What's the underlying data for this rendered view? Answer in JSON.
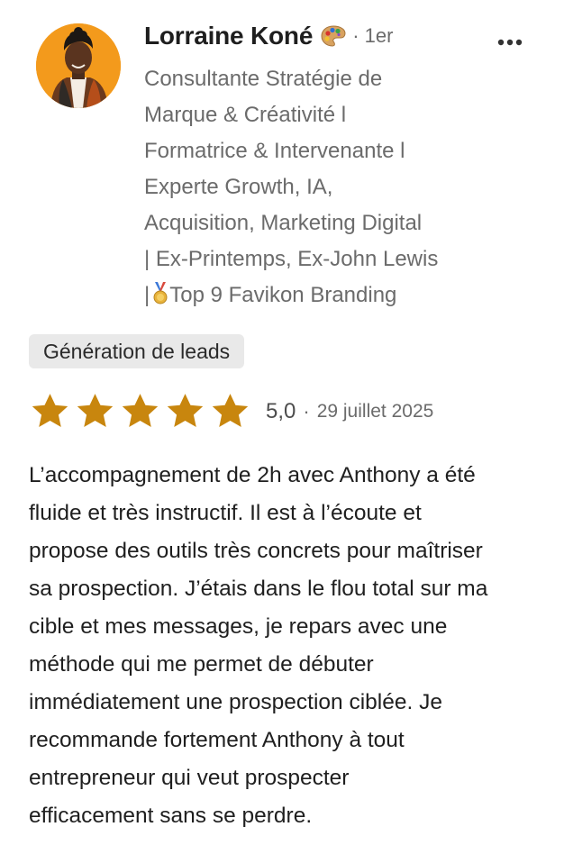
{
  "reviewer": {
    "name": "Lorraine Koné",
    "emoji_icon": "artist-palette-icon",
    "degree": "· 1er",
    "headline_lines": [
      "Consultante Stratégie de",
      "Marque & Créativité l",
      "Formatrice & Intervenante l",
      "Experte Growth, IA,",
      "Acquisition, Marketing Digital",
      "| Ex-Printemps, Ex-John Lewis"
    ],
    "headline_last_prefix": "|",
    "headline_last_icon": "medal-icon",
    "headline_last_text": "Top 9 Favikon Branding"
  },
  "menu": {
    "icon": "more-options-icon"
  },
  "tag": "Génération de leads",
  "rating": {
    "stars": 5,
    "score": "5,0",
    "separator": "·",
    "date": "29 juillet 2025",
    "star_color": "#c8860e"
  },
  "review_lines": [
    "L’accompagnement de 2h avec Anthony a été",
    "fluide et très instructif. Il est à l’écoute et",
    "propose des outils très concrets pour maîtriser",
    "sa prospection. J’étais dans le flou total sur ma",
    "cible et mes messages, je repars avec une",
    "méthode qui me permet de débuter",
    "immédiatement une prospection ciblée. Je",
    "recommande fortement Anthony à tout",
    "entrepreneur qui veut prospecter",
    "efficacement sans se perdre."
  ],
  "colors": {
    "avatar_bg": "#f39a1c",
    "tag_bg": "#e9e9e9",
    "muted_text": "#6b6b6b"
  }
}
